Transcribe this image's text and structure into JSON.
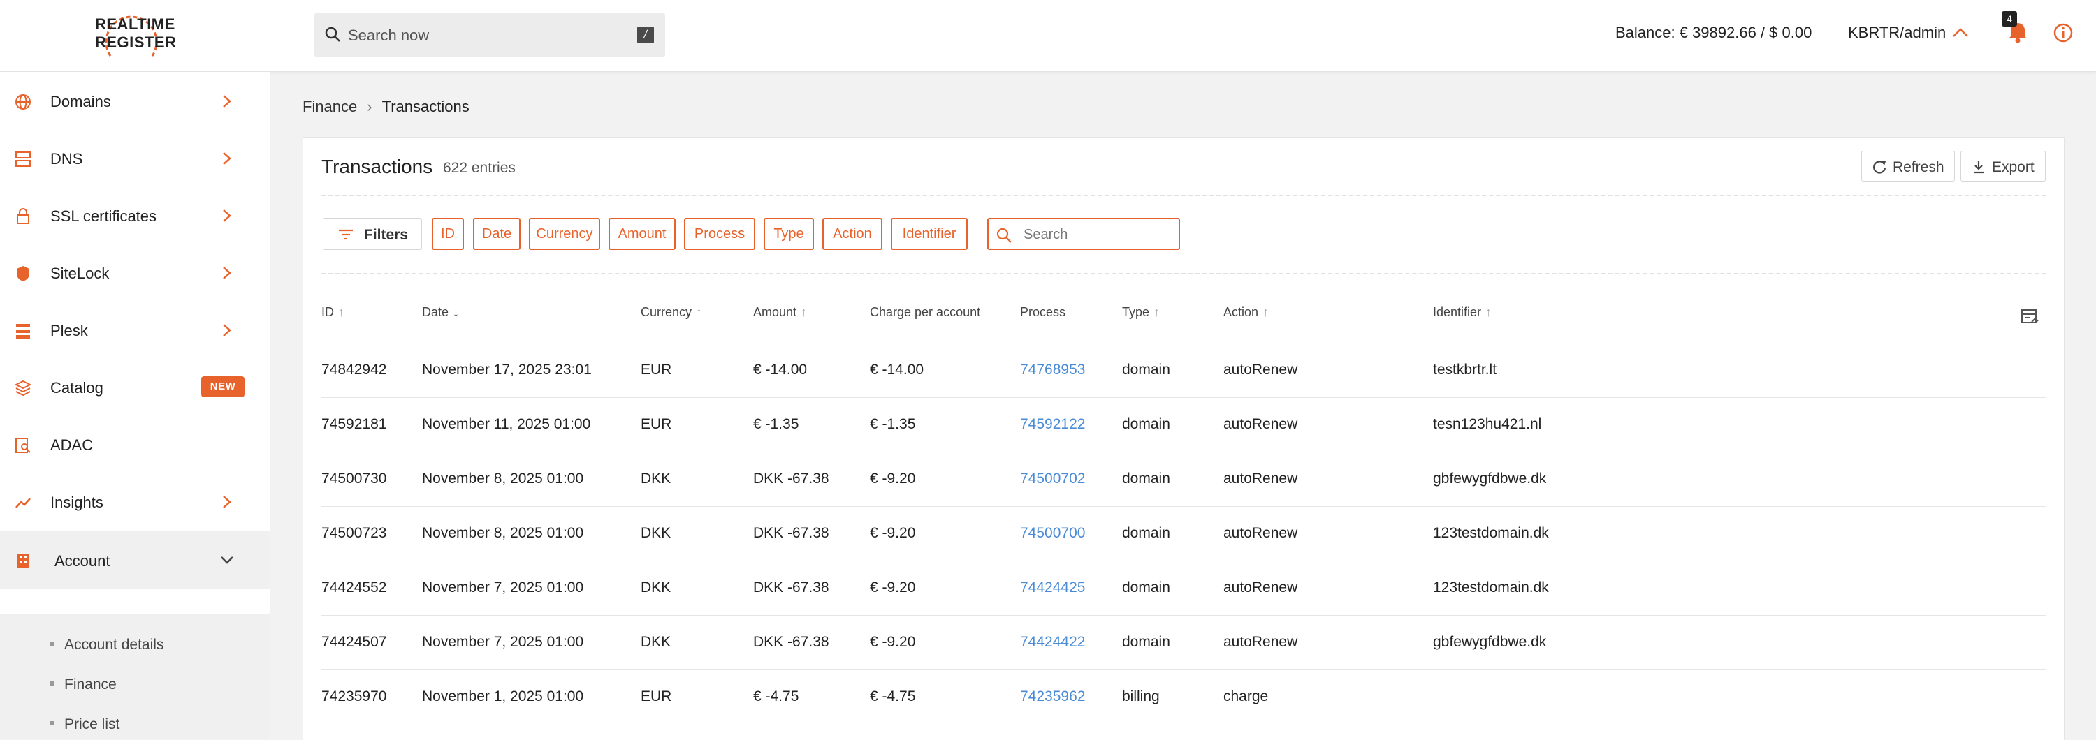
{
  "header": {
    "logo_line1": "REALTIME",
    "logo_line2": "REGISTER",
    "search_placeholder": "Search now",
    "search_shortcut": "/",
    "balance": "Balance: € 39892.66 / $ 0.00",
    "user": "KBRTR/admin",
    "notification_count": "4"
  },
  "sidebar": {
    "items": [
      {
        "label": "Domains",
        "icon": "globe-icon"
      },
      {
        "label": "DNS",
        "icon": "server-icon"
      },
      {
        "label": "SSL certificates",
        "icon": "lock-icon"
      },
      {
        "label": "SiteLock",
        "icon": "shield-icon"
      },
      {
        "label": "Plesk",
        "icon": "stack-icon"
      },
      {
        "label": "Catalog",
        "icon": "layers-icon",
        "badge": "NEW"
      },
      {
        "label": "ADAC",
        "icon": "report-icon"
      },
      {
        "label": "Insights",
        "icon": "trend-icon"
      },
      {
        "label": "Account",
        "icon": "building-icon"
      }
    ],
    "account_sub": [
      "Account details",
      "Finance",
      "Price list"
    ]
  },
  "breadcrumb": {
    "parent": "Finance",
    "current": "Transactions"
  },
  "card": {
    "title": "Transactions",
    "count": "622 entries",
    "refresh_label": "Refresh",
    "export_label": "Export",
    "filters_label": "Filters",
    "chips": [
      "ID",
      "Date",
      "Currency",
      "Amount",
      "Process",
      "Type",
      "Action",
      "Identifier"
    ],
    "search_placeholder": "Search"
  },
  "table": {
    "columns": [
      "ID",
      "Date",
      "Currency",
      "Amount",
      "Charge per account",
      "Process",
      "Type",
      "Action",
      "Identifier"
    ],
    "rows": [
      [
        "74842942",
        "November 17, 2025 23:01",
        "EUR",
        "€ -14.00",
        "€ -14.00",
        "74768953",
        "domain",
        "autoRenew",
        "testkbrtr.lt"
      ],
      [
        "74592181",
        "November 11, 2025 01:00",
        "EUR",
        "€ -1.35",
        "€ -1.35",
        "74592122",
        "domain",
        "autoRenew",
        "tesn123hu421.nl"
      ],
      [
        "74500730",
        "November 8, 2025 01:00",
        "DKK",
        "DKK -67.38",
        "€ -9.20",
        "74500702",
        "domain",
        "autoRenew",
        "gbfewygfdbwe.dk"
      ],
      [
        "74500723",
        "November 8, 2025 01:00",
        "DKK",
        "DKK -67.38",
        "€ -9.20",
        "74500700",
        "domain",
        "autoRenew",
        "123testdomain.dk"
      ],
      [
        "74424552",
        "November 7, 2025 01:00",
        "DKK",
        "DKK -67.38",
        "€ -9.20",
        "74424425",
        "domain",
        "autoRenew",
        "123testdomain.dk"
      ],
      [
        "74424507",
        "November 7, 2025 01:00",
        "DKK",
        "DKK -67.38",
        "€ -9.20",
        "74424422",
        "domain",
        "autoRenew",
        "gbfewygfdbwe.dk"
      ],
      [
        "74235970",
        "November 1, 2025 01:00",
        "EUR",
        "€ -4.75",
        "€ -4.75",
        "74235962",
        "billing",
        "charge",
        ""
      ]
    ]
  },
  "colors": {
    "accent": "#e8622c",
    "link": "#4a8bd6"
  }
}
